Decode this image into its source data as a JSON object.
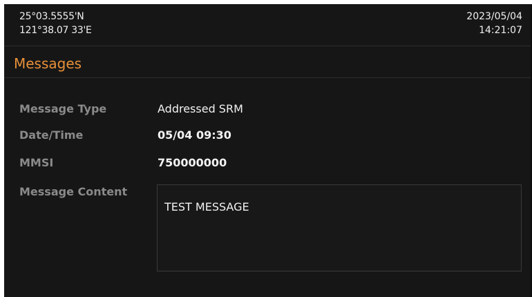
{
  "status_bar": {
    "latitude": "25°03.5555'N",
    "longitude": "121°38.07 33'E",
    "date": "2023/05/04",
    "time": "14:21:07"
  },
  "page": {
    "title": "Messages"
  },
  "fields": {
    "message_type": {
      "label": "Message Type",
      "value": "Addressed SRM"
    },
    "date_time": {
      "label": "Date/Time",
      "value": "05/04 09:30"
    },
    "mmsi": {
      "label": "MMSI",
      "value": "750000000"
    },
    "message_content": {
      "label": "Message Content",
      "value": "TEST MESSAGE"
    }
  },
  "colors": {
    "background": "#161616",
    "title_accent": "#e8903a",
    "label": "#8a8a8a",
    "value": "#f2f2f2",
    "divider": "#2e2e2e"
  }
}
